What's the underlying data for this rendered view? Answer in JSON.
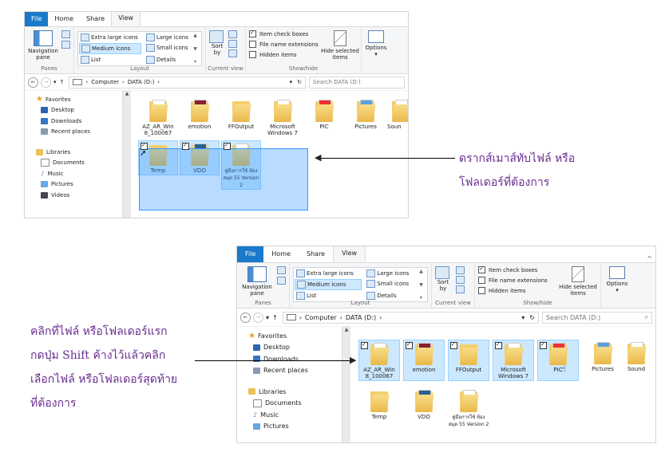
{
  "ribbon": {
    "tabs": [
      "File",
      "Home",
      "Share",
      "View"
    ],
    "navigation_pane_label": "Navigation pane",
    "panes_group": "Panes",
    "layout_options": [
      "Extra large icons",
      "Large icons",
      "Medium icons",
      "Small icons",
      "List",
      "Details"
    ],
    "layout_group": "Layout",
    "sort_label": "Sort by",
    "current_view_group": "Current view",
    "item_check_boxes": "Item check boxes",
    "file_name_extensions": "File name extensions",
    "hidden_items": "Hidden items",
    "hide_selected": "Hide selected items",
    "show_hide_group": "Show/hide",
    "options_label": "Options"
  },
  "address": {
    "path": [
      "Computer",
      "DATA (D:)"
    ],
    "search_placeholder": "Search DATA (D:)"
  },
  "nav": {
    "favorites": "Favorites",
    "favorite_items": [
      "Desktop",
      "Downloads",
      "Recent places"
    ],
    "libraries": "Libraries",
    "library_items": [
      "Documents",
      "Music",
      "Pictures",
      "Videos"
    ]
  },
  "shot1": {
    "row1": [
      "AZ_AR_Win 8_100067",
      "emotion",
      "FFOutput",
      "Microsoft Windows 7",
      "PIC",
      "Pictures",
      "Soun"
    ],
    "row2": [
      "Temp",
      "VDO",
      "คู่มือการใช้ ห้องสมุด 55 Version 2"
    ]
  },
  "shot2": {
    "row1": [
      "AZ_AR_Win 8_100067",
      "emotion",
      "FFOutput",
      "Microsoft Windows 7",
      "PIC",
      "Pictures",
      "Sound"
    ],
    "row2": [
      "Temp",
      "VDO",
      "คู่มือการใช้ ห้องสมุด 55 Version 2"
    ],
    "favorites_items": [
      "Desktop",
      "Downloads",
      "Recent places"
    ],
    "library_items": [
      "Documents",
      "Music",
      "Pictures"
    ]
  },
  "annotations": {
    "drag_note_line1": "ดรากส์เมาส์ทับไฟล์ หรือ",
    "drag_note_line2": "โฟลเดอร์ที่ต้องการ",
    "shift_note_line1": "คลิกที่ไฟล์ หรือโฟลเดอร์แรก",
    "shift_note_line2": "กดปุ่ม Shift ค้างไว้แล้วคลิก",
    "shift_note_line3": "เลือกไฟล์ หรือโฟลเดอร์สุดท้าย",
    "shift_note_line4": "ที่ต้องการ"
  }
}
